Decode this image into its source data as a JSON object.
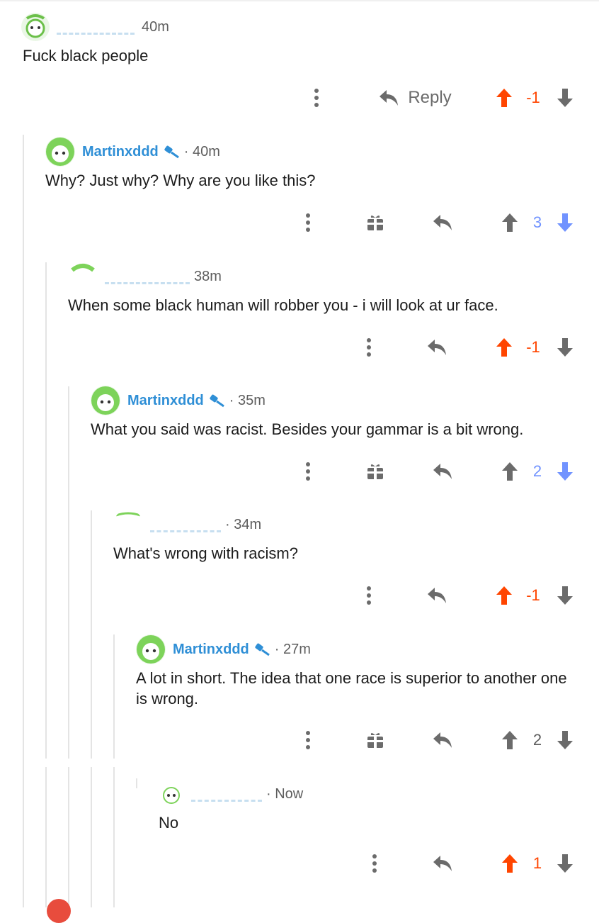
{
  "comments": [
    {
      "username": "",
      "time": "40m",
      "body": "Fuck black people",
      "score": "-1",
      "reply_label": "Reply"
    },
    {
      "username": "Martinxddd",
      "time": "40m",
      "body": "Why? Just why? Why are you like this?",
      "score": "3"
    },
    {
      "username": "",
      "time": "38m",
      "body": "When some black human will robber you - i will look at ur face.",
      "score": "-1"
    },
    {
      "username": "Martinxddd",
      "time": "35m",
      "body": "What you said was racist. Besides your gammar is a bit wrong.",
      "score": "2"
    },
    {
      "username": "",
      "time": "34m",
      "body": "What's wrong with racism?",
      "score": "-1"
    },
    {
      "username": "Martinxddd",
      "time": "27m",
      "body": "A lot in short. The idea that one race is superior to another one is wrong.",
      "score": "2"
    },
    {
      "username": "",
      "time": "Now",
      "body": "No",
      "score": "1"
    }
  ],
  "colors": {
    "upvote_active": "#ff4500",
    "downvote_active": "#7193ff",
    "username": "#2f8fd6",
    "neutral_icon": "#6b6b6b"
  },
  "icons": [
    "more-options-icon",
    "gift-icon",
    "reply-arrow-icon",
    "upvote-arrow-icon",
    "downvote-arrow-icon",
    "moderator-wand-icon",
    "avatar-snoo-icon"
  ]
}
